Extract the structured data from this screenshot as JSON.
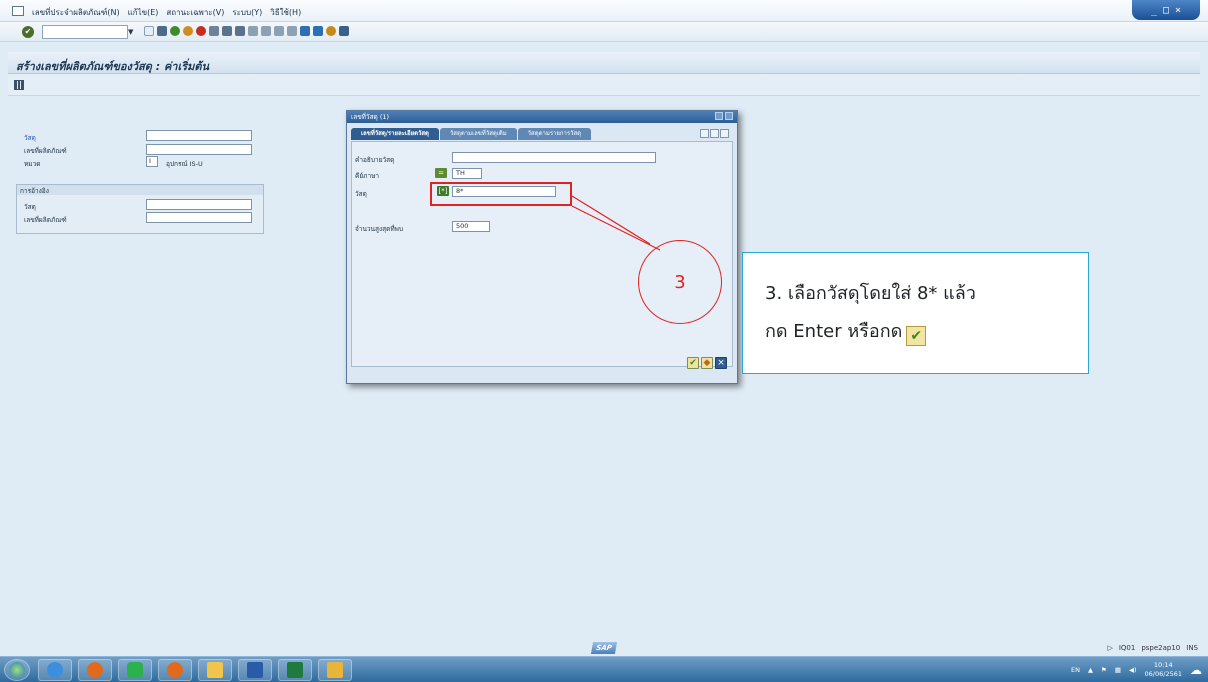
{
  "menu": {
    "items": [
      "เลขที่ประจำผลิตภัณฑ์(N)",
      "แก้ไข(E)",
      "สถานะเฉพาะ(V)",
      "ระบบ(Y)",
      "วิธีใช้(H)"
    ]
  },
  "window_controls": [
    "_",
    "□",
    "×"
  ],
  "page": {
    "title": "สร้างเลขที่ผลิตภัณฑ์ของวัสดุ : ค่าเริ่มต้น"
  },
  "form": {
    "material_label": "วัสดุ",
    "serial_label": "เลขที่ผลิตภัณฑ์",
    "category_label": "หมวด",
    "category_value": "I",
    "category_desc": "อุปกรณ์ IS-U",
    "reference_group": "การอ้างอิง",
    "ref_material_label": "วัสดุ",
    "ref_serial_label": "เลขที่ผลิตภัณฑ์"
  },
  "dialog": {
    "title": "เลขที่วัสดุ (1)",
    "tabs": [
      "เลขที่วัสดุ/รายละเอียดวัสดุ",
      "วัสดุตามเลขที่วัสดุเดิม",
      "วัสดุตามรายการวัสดุ"
    ],
    "desc_label": "คำอธิบายวัสดุ",
    "lang_label": "คีย์ภาษา",
    "lang_value": "TH",
    "material_label": "วัสดุ",
    "material_value": "8*",
    "max_hits_label": "จำนวนสูงสุดที่พบ",
    "max_hits_value": "500"
  },
  "annotation": {
    "step_number": "3",
    "line1": "3. เลือกวัสดุโดยใส่ 8* แล้ว",
    "line2": "กด Enter หรือกด"
  },
  "status": {
    "logo": "SAP",
    "system": "IQ01",
    "server": "pspe2ap10",
    "mode": "INS"
  },
  "taskbar": {
    "lang": "EN",
    "time": "10:14",
    "date": "06/06/2561"
  },
  "colors": {
    "sap_bg": "#dfebf5",
    "dialog_title": "#2d5e97",
    "highlight_red": "#e12222",
    "callout_blue": "#2aa7d6"
  }
}
